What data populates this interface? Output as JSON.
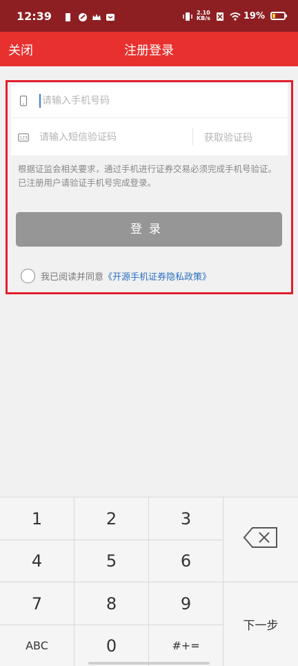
{
  "status_bar": {
    "time": "12:39",
    "net_speed_value": "2.10",
    "net_speed_unit": "KB/s",
    "battery": "19%"
  },
  "title_bar": {
    "close_label": "关闭",
    "title": "注册登录"
  },
  "form": {
    "phone_placeholder": "请输入手机号码",
    "phone_value": "",
    "code_placeholder": "请输入短信验证码",
    "code_value": "",
    "get_code_label": "获取验证码",
    "notice": "根据证监会相关要求，通过手机进行证券交易必须完成手机号验证。已注册用户请验证手机号完成登录。",
    "login_label": "登录",
    "agree_prefix": "我已阅读并同意",
    "policy_link": "《开源手机证券隐私政策》",
    "agree_checked": false
  },
  "keyboard": {
    "keys": [
      "1",
      "2",
      "3",
      "4",
      "5",
      "6",
      "7",
      "8",
      "9",
      "ABC",
      "0",
      "#+="
    ],
    "next_label": "下一步"
  },
  "colors": {
    "status_bar": "#8d1f22",
    "title_bar": "#e8312f",
    "highlight_border": "#e21e2c",
    "login_button": "#969696",
    "link": "#2b6fc0"
  }
}
